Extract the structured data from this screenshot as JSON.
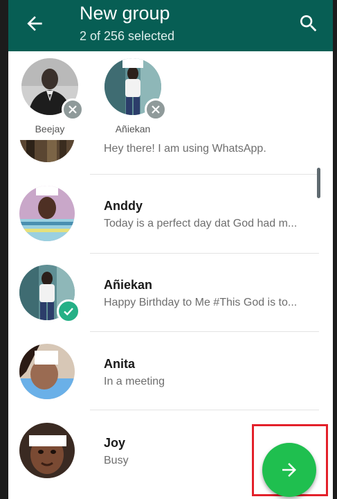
{
  "header": {
    "title": "New group",
    "subtitle": "2 of 256 selected",
    "back_icon": "arrow-left-icon",
    "search_icon": "search-icon"
  },
  "selected": [
    {
      "name": "Beejay"
    },
    {
      "name": "Añiekan"
    }
  ],
  "contacts": [
    {
      "name": "",
      "status": "Hey there! I am using WhatsApp.",
      "selected": false
    },
    {
      "name": "Anddy",
      "status": "Today is a perfect day dat God had m...",
      "selected": false
    },
    {
      "name": "Añiekan",
      "status": "Happy Birthday to Me #This God is to...",
      "selected": true
    },
    {
      "name": "Anita",
      "status": "In a meeting",
      "selected": false
    },
    {
      "name": "Joy",
      "status": "Busy",
      "selected": false
    }
  ],
  "fab": {
    "icon": "arrow-right-icon"
  },
  "colors": {
    "appbar": "#075e54",
    "fab": "#1fbf4f",
    "check": "#25b086",
    "highlight": "#e3202a"
  }
}
